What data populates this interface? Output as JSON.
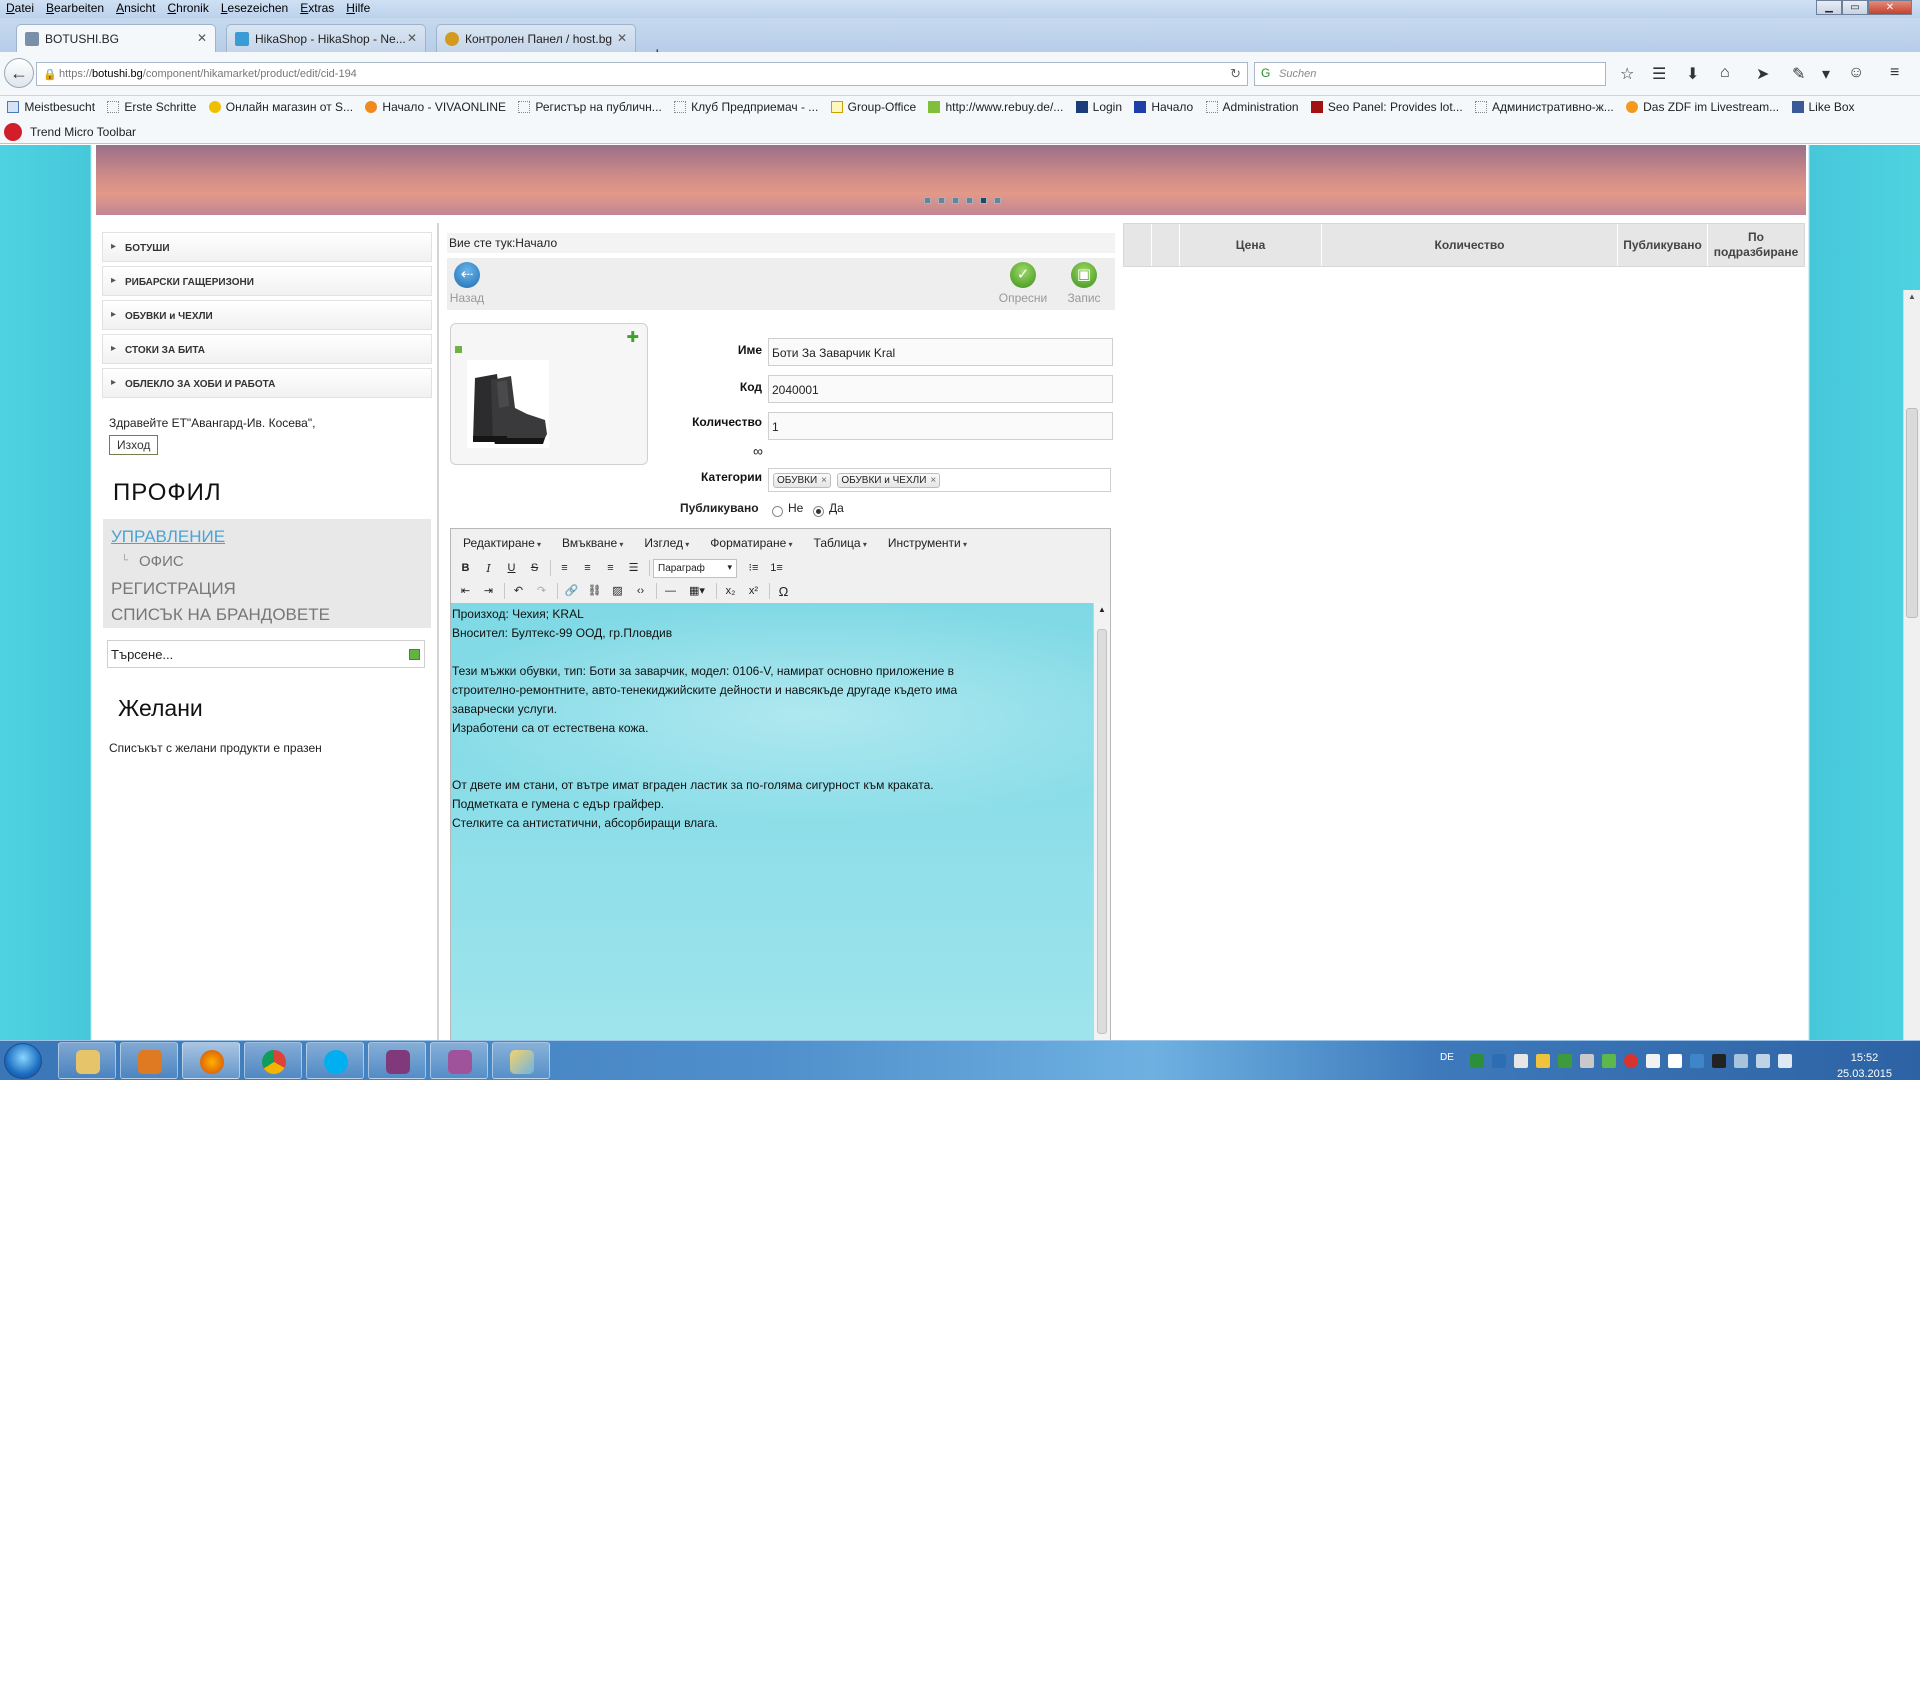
{
  "browser": {
    "menu": [
      "Datei",
      "Bearbeiten",
      "Ansicht",
      "Chronik",
      "Lesezeichen",
      "Extras",
      "Hilfe"
    ],
    "tabs": [
      {
        "label": "BOTUSHI.BG",
        "active": true
      },
      {
        "label": "HikaShop - HikaShop - Ne...",
        "active": false
      },
      {
        "label": "Контролен Панел / host.bg",
        "active": false
      }
    ],
    "url_prefix": "https://",
    "url_host": "botushi.bg",
    "url_path": "/component/hikamarket/product/edit/cid-194",
    "search_placeholder": "Suchen",
    "bookmarks": [
      "Meistbesucht",
      "Erste Schritte",
      "Онлайн магазин от S...",
      "Начало - VIVAONLINE",
      "Регистър на публичн...",
      "Клуб Предприемач - ...",
      "Group-Office",
      "http://www.rebuy.de/...",
      "Login",
      "Начало",
      "Administration",
      "Seo Panel: Provides lot...",
      "Административно-ж...",
      "Das ZDF im Livestream...",
      "Like Box"
    ],
    "trend_toolbar": "Trend Micro Toolbar"
  },
  "sidebar": {
    "categories": [
      "БОТУШИ",
      "РИБАРСКИ ГАЩЕРИЗОНИ",
      "ОБУВКИ и ЧЕХЛИ",
      "СТОКИ ЗА БИТА",
      "ОБЛЕКЛО ЗА ХОБИ И РАБОТА"
    ],
    "greeting": "Здравейте ЕТ\"Авангард-Ив. Косева\",",
    "logout": "Изход",
    "profile_title": "ПРОФИЛ",
    "profile_menu": {
      "manage": "УПРАВЛЕНИЕ",
      "office": "ОФИС",
      "register": "РЕГИСТРАЦИЯ",
      "brands": "СПИСЪК НА БРАНДОВЕТЕ"
    },
    "search_value": "Търсене...",
    "wishlist_title": "Желани",
    "wishlist_empty": "Списъкът с желани продукти е празен"
  },
  "main": {
    "breadcrumb": "Вие сте тук:Начало",
    "back": "Назад",
    "refresh": "Опресни",
    "save": "Запис",
    "labels": {
      "name": "Име",
      "code": "Код",
      "quantity": "Количество",
      "categories": "Категории",
      "published": "Публикувано",
      "no": "Не",
      "yes": "Да"
    },
    "name_value": "Боти За Заварчик Kral",
    "code_value": "2040001",
    "quantity_value": "1",
    "infinity": "∞",
    "category_chips": [
      "ОБУВКИ",
      "ОБУВКИ и ЧЕХЛИ"
    ],
    "published_selected": "Да"
  },
  "editor": {
    "menu": [
      "Редактиране",
      "Вмъкване",
      "Изглед",
      "Форматиране",
      "Таблица",
      "Инструменти"
    ],
    "format_select": "Параграф",
    "content": "Произход: Чехия; KRAL\nВносител: Бултекс-99 ООД, гр.Пловдив\n\nТези мъжки обувки, тип: Боти за заварчик, модел: 0106-V, намират основно приложение в\nстроително-ремонтните, авто-тенекиджийските дейности и навсякъде другаде където има\nзаварчески услуги.\nИзработени са от естествена кожа.\n\n\nОт двете им стани, от вътре имат вграден ластик за по-голяма сигурност към краката.\nПодметката е гумена с едър грайфер.\nСтелките са антистатични, абсорбиращи влага."
  },
  "right_table": {
    "columns": [
      "",
      "",
      "Цена",
      "Количество",
      "Публикувано",
      "По подразбиране"
    ]
  },
  "taskbar": {
    "lang": "DE",
    "time": "15:52",
    "date": "25.03.2015"
  },
  "colors": {
    "page_bg": "#4ed2e0",
    "editor_bg": "#89dde8",
    "accent_green": "#63b345",
    "link_blue": "#4aa3d6"
  }
}
